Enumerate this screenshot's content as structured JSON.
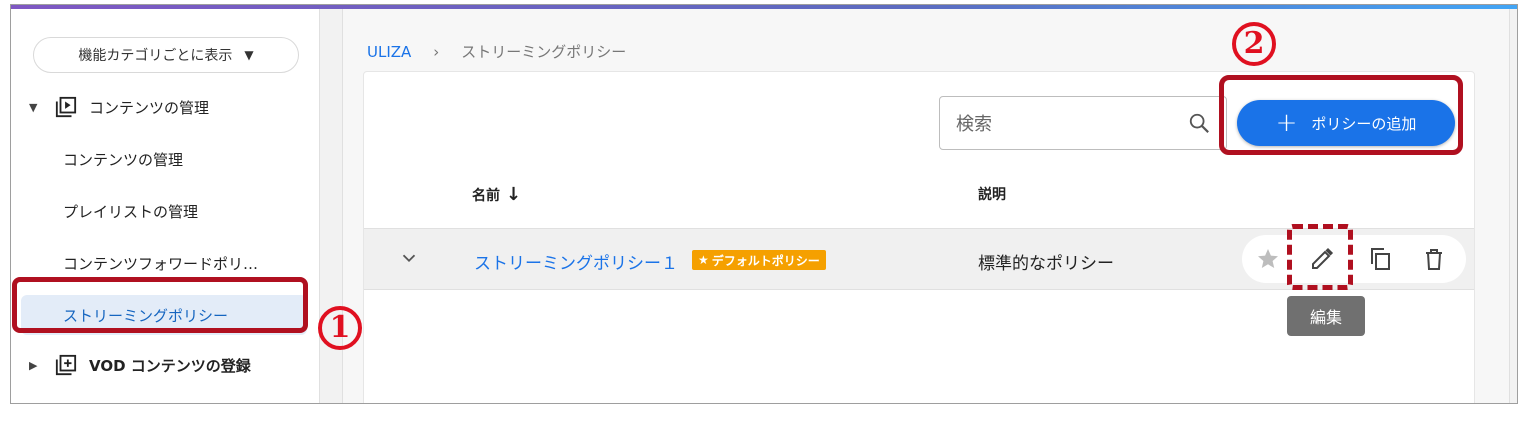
{
  "sidebar": {
    "category_select": "機能カテゴリごとに表示",
    "groups": [
      {
        "label": "コンテンツの管理"
      },
      {
        "label": "VOD コンテンツの登録"
      }
    ],
    "items": [
      {
        "label": "コンテンツの管理"
      },
      {
        "label": "プレイリストの管理"
      },
      {
        "label": "コンテンツフォワードポリ…"
      },
      {
        "label": "ストリーミングポリシー"
      }
    ]
  },
  "breadcrumb": {
    "root": "ULIZA",
    "separator": "›",
    "current": "ストリーミングポリシー"
  },
  "toolbar": {
    "search_placeholder": "検索",
    "add_button": "ポリシーの追加"
  },
  "table": {
    "columns": [
      "名前",
      "説明"
    ],
    "sort_indicator": "↓",
    "rows": [
      {
        "name": "ストリーミングポリシー１",
        "badge": "デフォルトポリシー",
        "description": "標準的なポリシー"
      }
    ]
  },
  "tooltip": "編集",
  "annotations": {
    "one": "1",
    "two": "2"
  },
  "colors": {
    "accent": "#1a73e8",
    "badge": "#f5a000",
    "annotation": "#e01020"
  }
}
